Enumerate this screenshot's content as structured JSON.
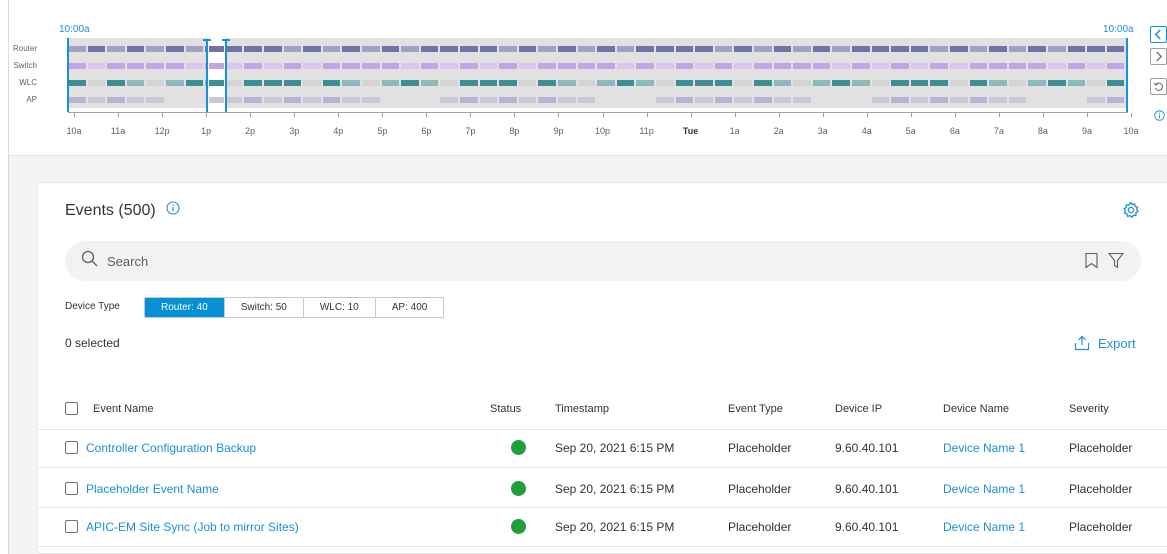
{
  "timeline": {
    "start_time": "10:00a",
    "end_time": "10:00a",
    "rows": [
      "Router",
      "Switch",
      "WLC",
      "AP"
    ],
    "tick_labels": [
      "10a",
      "11a",
      "12p",
      "1p",
      "2p",
      "3p",
      "4p",
      "5p",
      "6p",
      "7p",
      "8p",
      "9p",
      "10p",
      "11p",
      "Tue",
      "1a",
      "2a",
      "3a",
      "4a",
      "5a",
      "6a",
      "7a",
      "8a",
      "9a",
      "10a"
    ],
    "colors": {
      "router": "#6e74a8",
      "router_alt": "#9ea2c4",
      "switch": "#c2a4e8",
      "switch_alt": "#d7c6f0",
      "wlc": "#3a8f93",
      "wlc_alt": "#8ab8bb",
      "ap": "#c7c9d6",
      "ap_alt": "#b6b3d6",
      "accent": "#1b90d8"
    }
  },
  "events": {
    "title": "Events (500)",
    "search_placeholder": "Search",
    "device_type_label": "Device Type",
    "device_types": [
      "Router: 40",
      "Switch: 50",
      "WLC: 10",
      "AP: 400"
    ],
    "selected_count": "0 selected",
    "export_label": "Export",
    "columns": [
      "Event Name",
      "Status",
      "Timestamp",
      "Event Type",
      "Device IP",
      "Device Name",
      "Severity"
    ],
    "rows": [
      {
        "name": "Controller Configuration Backup",
        "timestamp": "Sep 20, 2021 6:15 PM",
        "type": "Placeholder",
        "ip": "9.60.40.101",
        "device": "Device Name 1",
        "severity": "Placeholder"
      },
      {
        "name": "Placeholder Event Name",
        "timestamp": "Sep 20, 2021 6:15 PM",
        "type": "Placeholder",
        "ip": "9.60.40.101",
        "device": "Device Name 1",
        "severity": "Placeholder"
      },
      {
        "name": "APIC-EM Site Sync (Job to mirror Sites)",
        "timestamp": "Sep 20, 2021 6:15 PM",
        "type": "Placeholder",
        "ip": "9.60.40.101",
        "device": "Device Name 1",
        "severity": "Placeholder"
      }
    ],
    "status_color": "#1f9e3c"
  }
}
